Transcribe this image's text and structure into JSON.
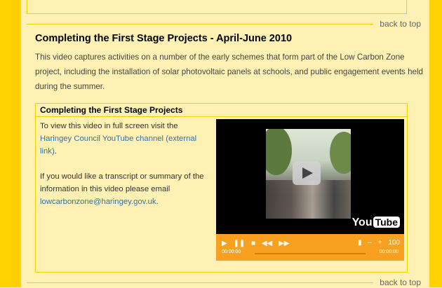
{
  "back_link_label": "back to top",
  "section": {
    "title": "Completing the First Stage Projects - April-June 2010",
    "description": "This video captures activities on a number of the early schemes that form part of the Low Carbon Zone project, including the installation of solar photovoltaic panels at schools, and public engagement events held during the summer."
  },
  "video_box": {
    "header": "Completing the First Stage Projects",
    "intro_text": "To view this video in full screen visit the",
    "channel_link": "Haringey Council YouTube channel (external link)",
    "after_link": ".",
    "transcript_text": "If you would like a transcript or summary of the information in this video please email",
    "email_link": "lowcarbonzone@haringey.gov.uk",
    "after_email": "."
  },
  "player": {
    "logo_you": "You",
    "logo_tube": "Tube",
    "play_icon": "▶",
    "pause_icon": "❚❚",
    "stop_icon": "■",
    "rewind_icon": "◀◀",
    "forward_icon": "▶▶",
    "mute_icon": "▮",
    "vol_down_icon": "–",
    "vol_up_icon": "+",
    "volume": "100",
    "time_current": "00:00:00",
    "time_total": "00:00:00",
    "accent_color": "#F8A020"
  },
  "colors": {
    "stripe": "#FFD100",
    "background": "#FFF0B3",
    "link": "#2E73A8"
  }
}
